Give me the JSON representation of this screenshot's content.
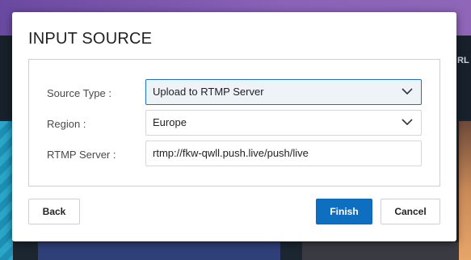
{
  "dialog": {
    "title": "INPUT SOURCE",
    "fields": [
      {
        "label": "Source Type :",
        "value": "Upload to RTMP Server",
        "kind": "select"
      },
      {
        "label": "Region :",
        "value": "Europe",
        "kind": "select"
      },
      {
        "label": "RTMP Server :",
        "value": "rtmp://fkw-qwll.push.live/push/live",
        "kind": "text"
      }
    ],
    "buttons": {
      "back": "Back",
      "finish": "Finish",
      "cancel": "Cancel"
    }
  },
  "background": {
    "peek_text": "RL"
  },
  "colors": {
    "primary": "#0e6fc1",
    "focus_border": "#1a73c8",
    "header_purple": "#8a62b8"
  }
}
